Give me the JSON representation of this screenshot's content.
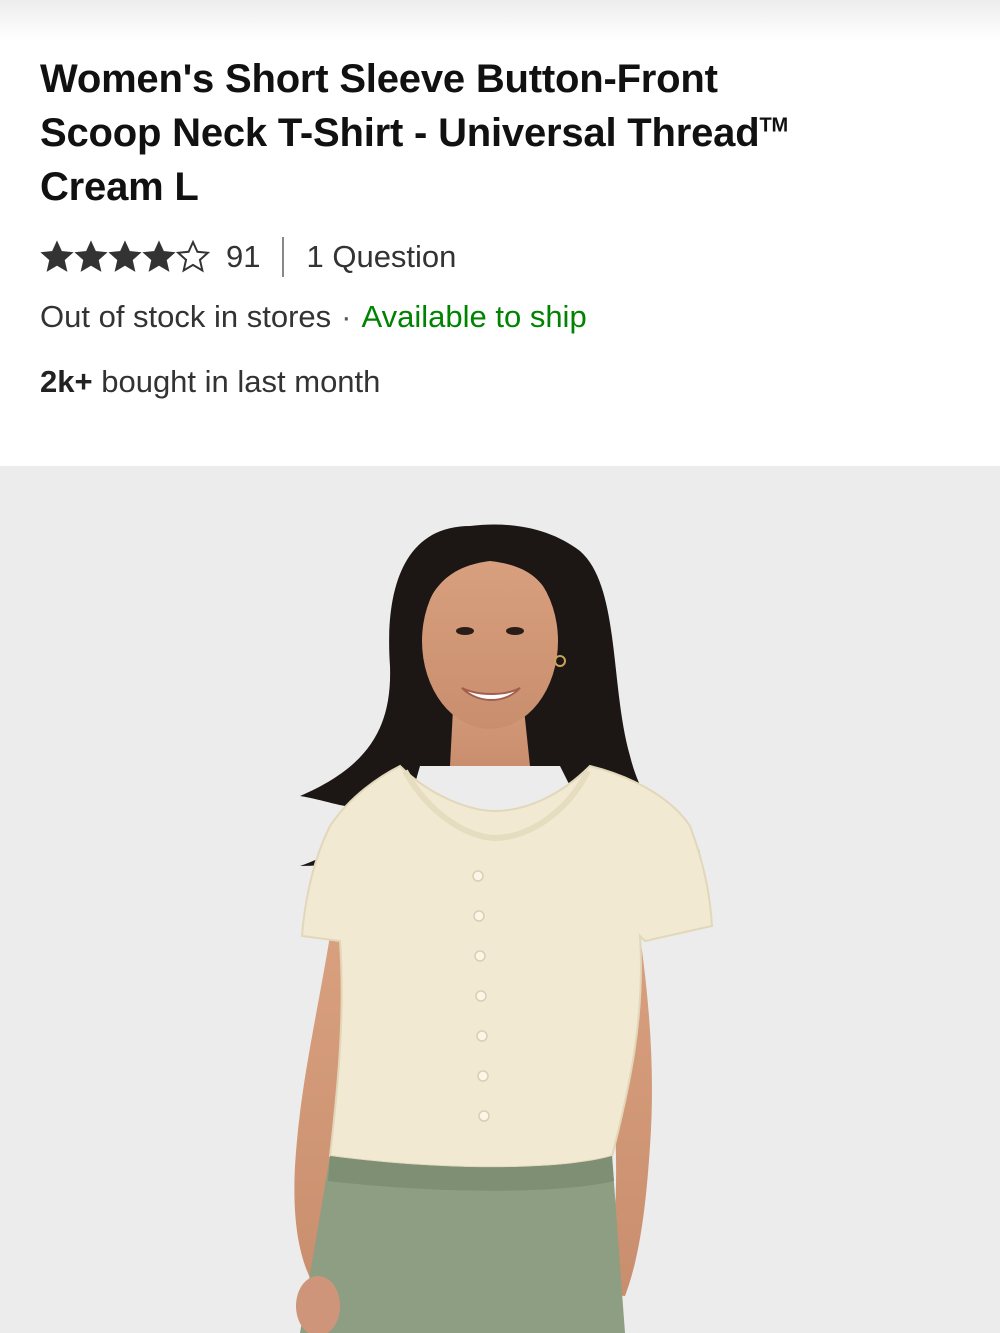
{
  "product": {
    "title_line1": "Women's Short Sleeve Button-Front",
    "title_line2": "Scoop Neck T-Shirt - Universal Thread",
    "trademark": "TM",
    "title_line3": "Cream L",
    "rating": 4,
    "rating_max": 5,
    "review_count": "91",
    "questions_label": "1 Question",
    "stock_status": "Out of stock in stores",
    "separator": "·",
    "ship_status": "Available to ship",
    "bought_count": "2k+",
    "bought_suffix": "bought in last month",
    "image_alt": "Model wearing cream short sleeve button-front scoop neck t-shirt with green pants"
  },
  "colors": {
    "ship_green": "#008300",
    "image_background": "#ececec",
    "shirt_cream": "#f1e9d2",
    "pants_green": "#8e9e82"
  }
}
